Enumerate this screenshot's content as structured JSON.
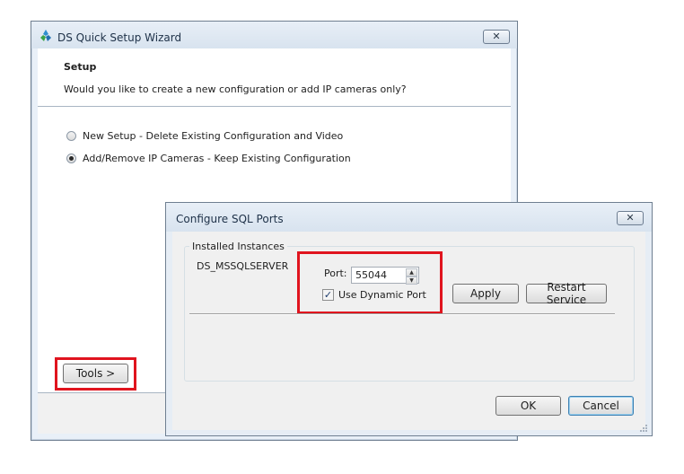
{
  "wizard": {
    "title": "DS Quick Setup Wizard",
    "close_symbol": "✕",
    "header_title": "Setup",
    "header_subtitle": "Would you like to create a new configuration or add IP cameras only?",
    "options": [
      {
        "label": "New Setup - Delete Existing Configuration and Video",
        "selected": false
      },
      {
        "label": "Add/Remove IP Cameras - Keep Existing Configuration",
        "selected": true
      }
    ],
    "tools_label": "Tools >"
  },
  "sql_dialog": {
    "title": "Configure SQL Ports",
    "close_symbol": "✕",
    "group_label": "Installed Instances",
    "instance_name": "DS_MSSQLSERVER",
    "port_label": "Port:",
    "port_value": "55044",
    "dynamic_port_label": "Use Dynamic Port",
    "dynamic_port_checked": true,
    "apply_label": "Apply",
    "restart_label": "Restart Service",
    "ok_label": "OK",
    "cancel_label": "Cancel"
  },
  "colors": {
    "highlight": "#e0141e",
    "window_frame": "#e9f0f8",
    "focus_border": "#3c7fb1"
  },
  "icons": [
    "app-logo-icon",
    "close-icon",
    "radio-icon",
    "spin-up-icon",
    "spin-down-icon",
    "checkbox-check-icon",
    "resize-grip-icon"
  ]
}
